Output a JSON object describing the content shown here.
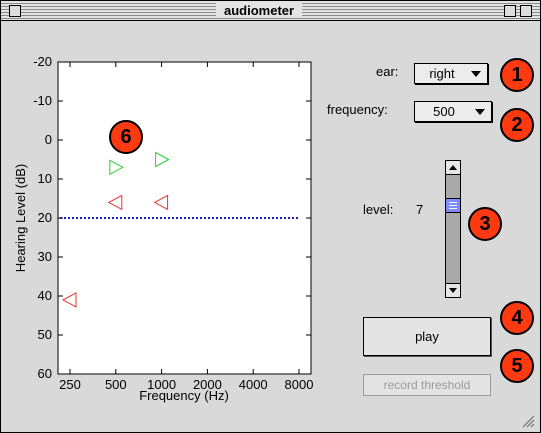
{
  "window": {
    "title": "audiometer"
  },
  "controls": {
    "ear_label": "ear:",
    "ear_value": "right",
    "frequency_label": "frequency:",
    "frequency_value": "500",
    "level_label": "level:",
    "level_value": "7",
    "level_slider": {
      "min": -10,
      "max": 60,
      "value": 7
    },
    "play_label": "play",
    "record_label": "record threshold"
  },
  "badges": [
    "1",
    "2",
    "3",
    "4",
    "5",
    "6"
  ],
  "colors": {
    "left_ear": "#e83030",
    "right_ear": "#2ad12a",
    "reference_line": "#1a1ac8",
    "badge": "#ff3a10",
    "slider_thumb": "#7c8cff"
  },
  "chart_data": {
    "type": "scatter",
    "xlabel": "Frequency (Hz)",
    "ylabel": "Hearing Level (dB)",
    "x_ticks": [
      "250",
      "500",
      "1000",
      "2000",
      "4000",
      "8000"
    ],
    "y_ticks": [
      "-20",
      "-10",
      "0",
      "10",
      "20",
      "30",
      "40",
      "50",
      "60"
    ],
    "ylim": [
      60,
      -20
    ],
    "y_inverted": true,
    "x_scale": "log2",
    "series": [
      {
        "marker": "left-triangle",
        "color": "#e83030",
        "points": [
          [
            250,
            41
          ],
          [
            500,
            16
          ],
          [
            1000,
            16
          ]
        ]
      },
      {
        "marker": "right-triangle",
        "color": "#2ad12a",
        "points": [
          [
            500,
            7
          ],
          [
            1000,
            5
          ]
        ]
      }
    ],
    "reference_line": {
      "y": 20,
      "style": "dotted",
      "color": "#1a1ac8"
    },
    "grid": false
  }
}
